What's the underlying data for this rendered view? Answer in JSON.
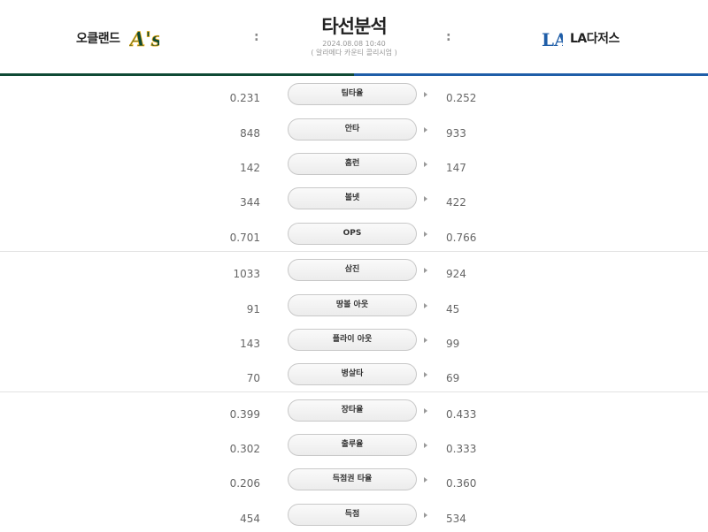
{
  "header": {
    "title": "타선분석",
    "datetime": "2024.08.08 10:40",
    "note": "( 알라메다 카운티 콜리시엄 )",
    "separator": ":"
  },
  "teams": {
    "left": {
      "name": "오클랜드",
      "logo_text": "A's",
      "color": "#0f4a35",
      "accent": "#efb21e"
    },
    "right": {
      "name": "LA다저스",
      "logo_text": "LA",
      "color": "#1f5ea8"
    }
  },
  "groups": [
    {
      "rows": [
        {
          "label": "팀타율",
          "left": "0.231",
          "right": "0.252"
        },
        {
          "label": "안타",
          "left": "848",
          "right": "933"
        },
        {
          "label": "홈런",
          "left": "142",
          "right": "147"
        },
        {
          "label": "볼넷",
          "left": "344",
          "right": "422"
        },
        {
          "label": "OPS",
          "left": "0.701",
          "right": "0.766"
        }
      ]
    },
    {
      "rows": [
        {
          "label": "삼진",
          "left": "1033",
          "right": "924"
        },
        {
          "label": "땅볼 아웃",
          "left": "91",
          "right": "45"
        },
        {
          "label": "플라이 아웃",
          "left": "143",
          "right": "99"
        },
        {
          "label": "병살타",
          "left": "70",
          "right": "69"
        }
      ]
    },
    {
      "rows": [
        {
          "label": "장타율",
          "left": "0.399",
          "right": "0.433"
        },
        {
          "label": "출루율",
          "left": "0.302",
          "right": "0.333"
        },
        {
          "label": "득점권 타율",
          "left": "0.206",
          "right": "0.360"
        },
        {
          "label": "득점",
          "left": "454",
          "right": "534"
        }
      ]
    }
  ]
}
